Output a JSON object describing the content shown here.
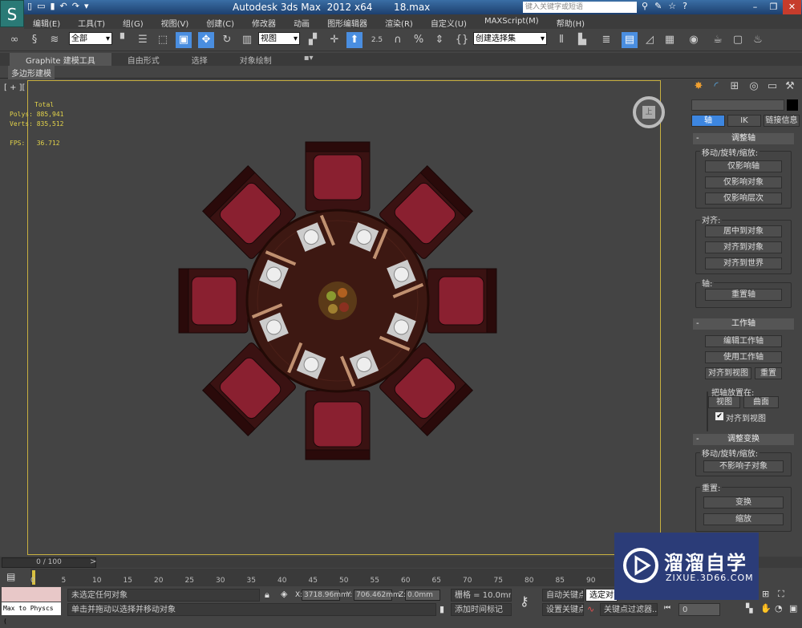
{
  "app": {
    "title": "Autodesk 3ds Max  2012 x64       18.max",
    "search_placeholder": "键入关键字或短语"
  },
  "menu": [
    "编辑(E)",
    "工具(T)",
    "组(G)",
    "视图(V)",
    "创建(C)",
    "修改器",
    "动画",
    "图形编辑器",
    "渲染(R)",
    "自定义(U)",
    "MAXScript(M)",
    "帮助(H)"
  ],
  "toolbar": {
    "filter": "全部",
    "ref_coord": "视图",
    "snap_angle": "2.5",
    "named_selection": "创建选择集"
  },
  "ribbon": {
    "tabs": [
      "Graphite 建模工具",
      "自由形式",
      "选择",
      "对象绘制"
    ],
    "sub": "多边形建模"
  },
  "viewport": {
    "label": "[ + ][ 顶 ][ 真实 ]",
    "stats": {
      "total": "Total",
      "polys_label": "Polys:",
      "polys": "885,941",
      "verts_label": "Verts:",
      "verts": "835,512",
      "fps_label": "FPS:",
      "fps": "36.712"
    },
    "viewcube": "上"
  },
  "cmdpanel": {
    "tabs": [
      "轴",
      "IK",
      "链接信息"
    ],
    "adjust_pivot": {
      "title": "调整轴",
      "group1": "移动/旋转/缩放:",
      "b1": "仅影响轴",
      "b2": "仅影响对象",
      "b3": "仅影响层次",
      "group2": "对齐:",
      "b4": "居中到对象",
      "b5": "对齐到对象",
      "b6": "对齐到世界",
      "group3": "轴:",
      "b7": "重置轴"
    },
    "working_pivot": {
      "title": "工作轴",
      "b1": "编辑工作轴",
      "b2": "使用工作轴",
      "b3": "对齐到视图",
      "b4": "重置",
      "group": "把轴放置在:",
      "b5": "视图",
      "b6": "曲面",
      "check": "对齐到视图",
      "checked": true
    },
    "adjust_transform": {
      "title": "调整变换",
      "group1": "移动/旋转/缩放:",
      "b1": "不影响子对象",
      "group2": "重置:",
      "b2": "变换",
      "b3": "缩放"
    }
  },
  "timeline": {
    "frame": "0 / 100",
    "ticks": [
      "0",
      "5",
      "10",
      "15",
      "20",
      "25",
      "30",
      "35",
      "40",
      "45",
      "50",
      "55",
      "60",
      "65",
      "70",
      "75",
      "80",
      "85",
      "90"
    ]
  },
  "status": {
    "script": "Max to Physcs (",
    "selection": "未选定任何对象",
    "prompt": "单击并拖动以选择并移动对象",
    "x_label": "X:",
    "x": "3718.96mm",
    "y_label": "Y:",
    "y": "706.462mm",
    "z_label": "Z:",
    "z": "0.0mm",
    "grid": "栅格 = 10.0mm",
    "add_tag": "添加时间标记",
    "auto_key": "自动关键点",
    "set_key": "设置关键点",
    "selected": "选定对象",
    "key_filters": "关键点过滤器...",
    "frame": "0"
  },
  "watermark": {
    "name": "溜溜自学",
    "url": "ZIXUE.3D66.COM"
  }
}
